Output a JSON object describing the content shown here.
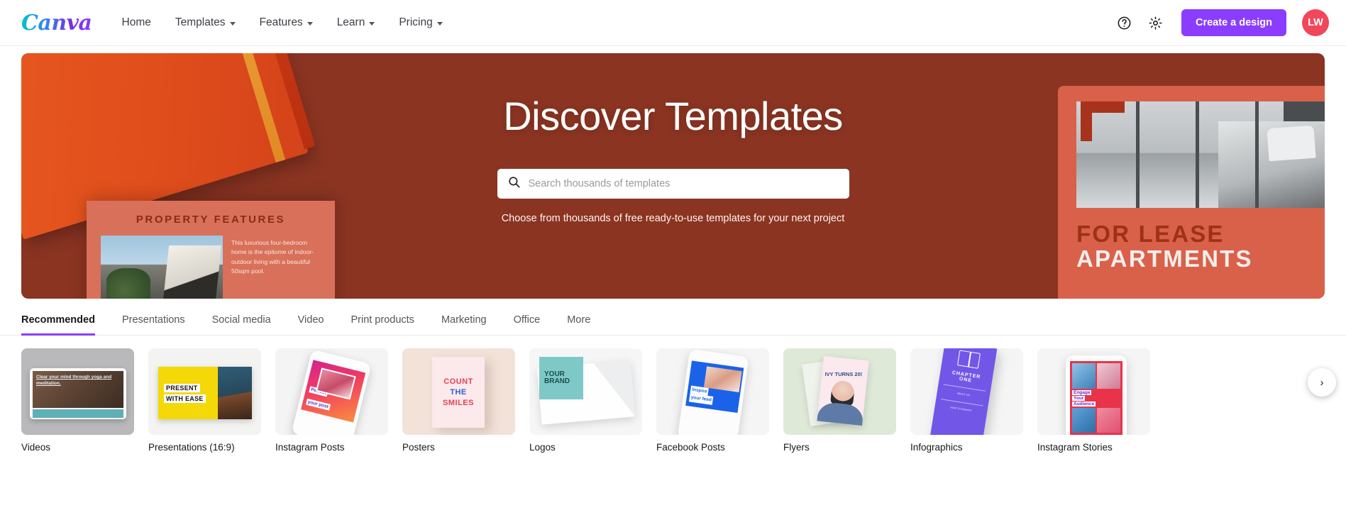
{
  "header": {
    "logo": "Canva",
    "nav": [
      {
        "label": "Home",
        "has_caret": false
      },
      {
        "label": "Templates",
        "has_caret": true
      },
      {
        "label": "Features",
        "has_caret": true
      },
      {
        "label": "Learn",
        "has_caret": true
      },
      {
        "label": "Pricing",
        "has_caret": true
      }
    ],
    "help_icon": "help-circle-icon",
    "settings_icon": "gear-icon",
    "cta_label": "Create a design",
    "avatar_initials": "LW",
    "avatar_color": "#f0475b",
    "accent_color": "#8b3dff"
  },
  "hero": {
    "title": "Discover Templates",
    "search_placeholder": "Search thousands of templates",
    "search_value": "",
    "search_icon": "search-icon",
    "subtitle": "Choose from thousands of free ready-to-use templates for your next project",
    "background_color": "#8b3422",
    "left_art": {
      "brochure_title": "PROPERTY FEATURES",
      "brochure_body": "This luxurious four-bedroom home is the epitome of indoor-outdoor living with a beautiful 50sqm pool."
    },
    "right_art": {
      "line1": "FOR LEASE",
      "line2": "APARTMENTS"
    }
  },
  "tabs": {
    "active": "Recommended",
    "items": [
      {
        "label": "Recommended"
      },
      {
        "label": "Presentations"
      },
      {
        "label": "Social media"
      },
      {
        "label": "Video"
      },
      {
        "label": "Print products"
      },
      {
        "label": "Marketing"
      },
      {
        "label": "Office"
      },
      {
        "label": "More"
      }
    ]
  },
  "cards": [
    {
      "label": "Videos",
      "art_text": "Clear your mind through yoga and meditation."
    },
    {
      "label": "Presentations (16:9)",
      "art_text": "PRESENT",
      "art_text2": "WITH EASE"
    },
    {
      "label": "Instagram Posts",
      "art_text": "Perfect",
      "art_text2": "your post"
    },
    {
      "label": "Posters",
      "art_text": "COUNT",
      "art_text2": "THE",
      "art_text3": "SMILES"
    },
    {
      "label": "Logos",
      "art_text": "YOUR",
      "art_text2": "BRAND"
    },
    {
      "label": "Facebook Posts",
      "art_text": "Inspire",
      "art_text2": "your feed"
    },
    {
      "label": "Flyers",
      "art_text": "IVY TURNS 20!"
    },
    {
      "label": "Infographics",
      "art_text": "CHAPTER ONE"
    },
    {
      "label": "Instagram Stories",
      "art_text": "Engage",
      "art_text2": "Your",
      "art_text3": "Audience"
    }
  ],
  "carousel": {
    "next_icon": "chevron-right-icon",
    "next_label": "›"
  }
}
